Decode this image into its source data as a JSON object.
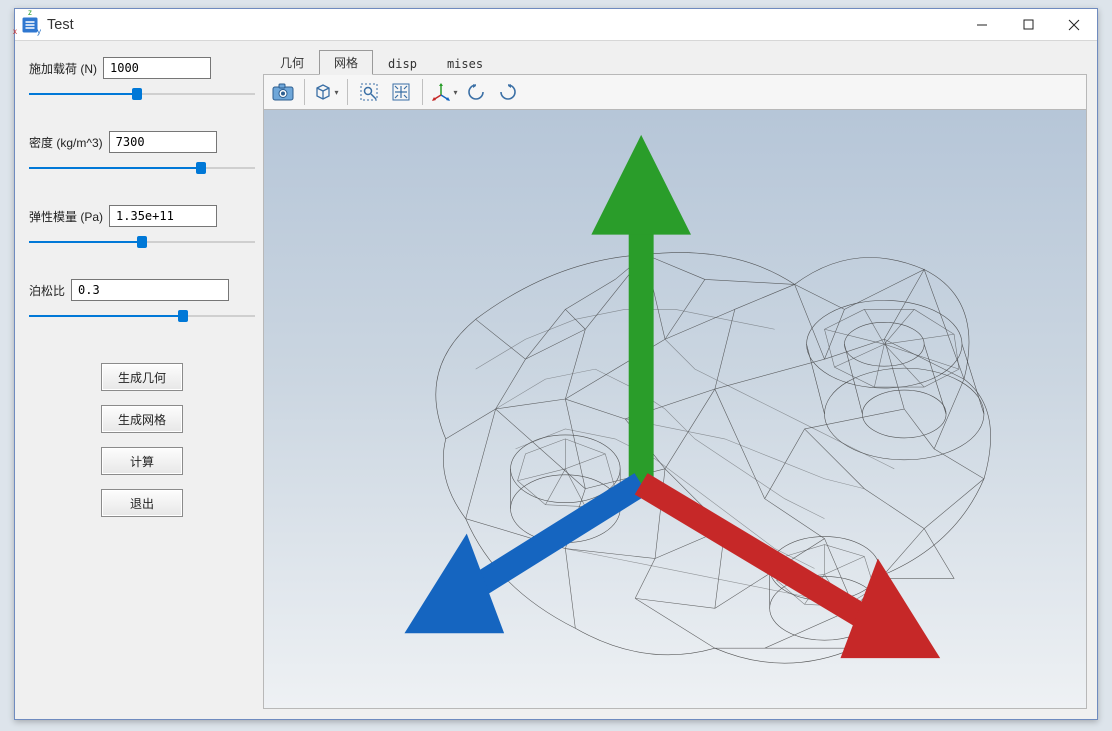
{
  "window": {
    "title": "Test"
  },
  "params": {
    "load": {
      "label": "施加载荷 (N)",
      "value": "1000",
      "pct": 48
    },
    "density": {
      "label": "密度 (kg/m^3)",
      "value": "7300",
      "pct": 76
    },
    "young": {
      "label": "弹性模量 (Pa)",
      "value": "1.35e+11",
      "pct": 50
    },
    "poisson": {
      "label": "泊松比",
      "value": "0.3",
      "pct": 68
    }
  },
  "buttons": {
    "gen_geom": "生成几何",
    "gen_mesh": "生成网格",
    "compute": "计算",
    "exit": "退出"
  },
  "tabs": [
    {
      "id": "geom",
      "label": "几何",
      "active": false
    },
    {
      "id": "mesh",
      "label": "网格",
      "active": true
    },
    {
      "id": "disp",
      "label": "disp",
      "active": false
    },
    {
      "id": "mises",
      "label": "mises",
      "active": false
    }
  ],
  "toolbar_icons": {
    "snapshot": "camera-icon",
    "view_cube": "cube-icon",
    "zoom_area": "zoom-rect-icon",
    "fit_view": "fit-icon",
    "axes": "axes-icon",
    "rotate_ccw": "rotate-ccw-icon",
    "rotate_cw": "rotate-cw-icon"
  },
  "axis_labels": {
    "x": "x",
    "y": "y",
    "z": "z"
  }
}
